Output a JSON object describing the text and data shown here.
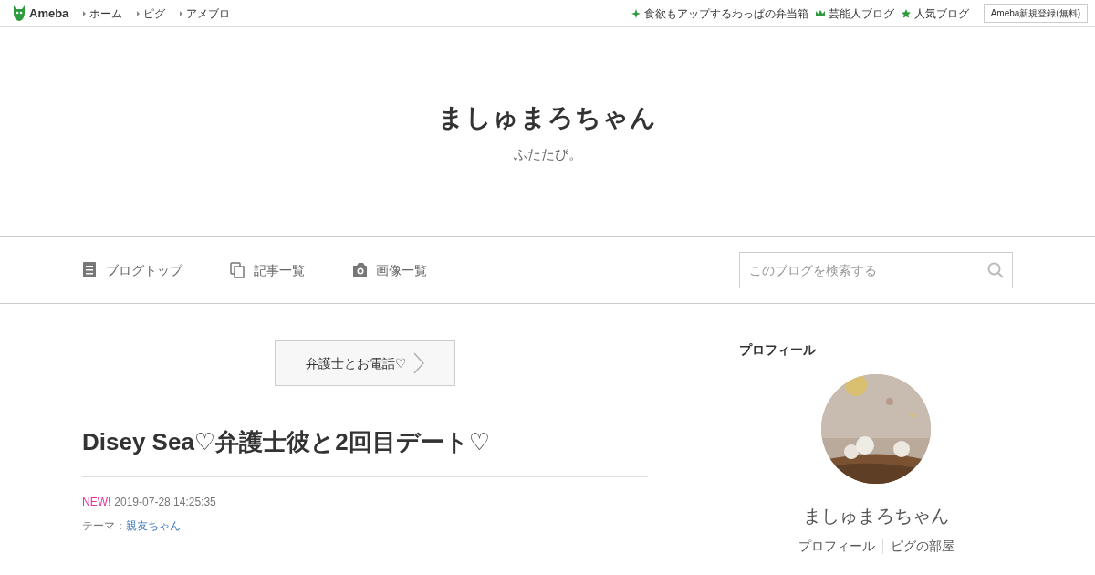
{
  "topbar": {
    "logo": "Ameba",
    "links": [
      "ホーム",
      "ピグ",
      "アメブロ"
    ],
    "right_links": [
      {
        "kind": "sparkle",
        "label": "食欲もアップするわっぱの弁当箱"
      },
      {
        "kind": "crown",
        "label": "芸能人ブログ"
      },
      {
        "kind": "star",
        "label": "人気ブログ"
      }
    ],
    "signup": "Ameba新規登録(無料)"
  },
  "header": {
    "title": "ましゅまろちゃん",
    "subtitle": "ふたたび。"
  },
  "nav": {
    "items": [
      {
        "kind": "top",
        "label": "ブログトップ"
      },
      {
        "kind": "list",
        "label": "記事一覧"
      },
      {
        "kind": "images",
        "label": "画像一覧"
      }
    ],
    "search": {
      "placeholder": "このブログを検索する"
    }
  },
  "article": {
    "next_link": "弁護士とお電話♡",
    "title": "Disey Sea♡弁護士彼と2回目デート♡",
    "new_badge": "NEW!",
    "date": "2019-07-28 14:25:35",
    "theme_label": "テーマ：",
    "theme": "親友ちゃん"
  },
  "sidebar": {
    "heading": "プロフィール",
    "name": "ましゅまろちゃん",
    "links": [
      "プロフィール",
      "ピグの部屋"
    ]
  }
}
